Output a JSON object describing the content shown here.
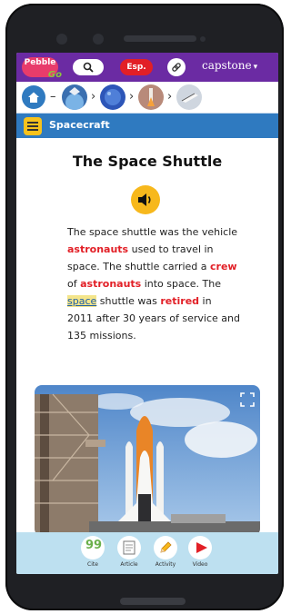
{
  "topbar": {
    "logo_text": "Pebble",
    "logo_go": "Go",
    "esp_label": "Esp.",
    "brand": "capstone",
    "brand_caret": "▾"
  },
  "section": {
    "title": "Spacecraft"
  },
  "article": {
    "title": "The Space Shuttle",
    "segments": [
      {
        "t": "The space shuttle was the vehicle "
      },
      {
        "t": "astronauts",
        "k": "kw"
      },
      {
        "t": " used to travel in space. The shuttle carried a "
      },
      {
        "t": "crew",
        "k": "kw"
      },
      {
        "t": " of "
      },
      {
        "t": "astronauts",
        "k": "kw"
      },
      {
        "t": " into space. The "
      },
      {
        "t": "space",
        "k": "hl"
      },
      {
        "t": " shuttle was "
      },
      {
        "t": "retired",
        "k": "kw"
      },
      {
        "t": " in 2011 after 30 years of service and 135 missions."
      }
    ]
  },
  "toolbar": {
    "cite": "Cite",
    "article": "Article",
    "activity": "Activity",
    "video": "Video",
    "cite_icon_text": "99"
  },
  "colors": {
    "purple": "#6b2ba3",
    "blue": "#2f7ac0",
    "red": "#e21f26",
    "yellow": "#f7b81c",
    "toolbar": "#bde0f0"
  }
}
